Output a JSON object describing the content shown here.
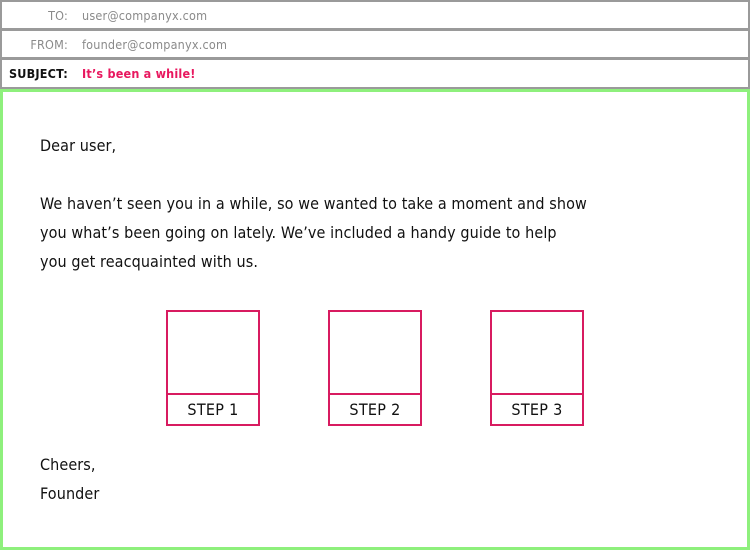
{
  "email": {
    "to_label": "TO:",
    "to_value": "user@companyx.com",
    "from_label": "FROM:",
    "from_value": "founder@companyx.com",
    "subject_label": "SUBJECT:",
    "subject_value": "It’s been a while!"
  },
  "body": {
    "greeting": "Dear user,",
    "paragraph_lines": [
      "We haven’t seen you in a while, so we wanted to take a moment and show",
      "you what’s been going on lately.  We’ve included a handy guide to help",
      "you get reacquainted with us."
    ],
    "steps": [
      {
        "label": "STEP 1"
      },
      {
        "label": "STEP 2"
      },
      {
        "label": "STEP 3"
      }
    ],
    "signoff": "Cheers,",
    "signature": "Founder"
  },
  "colors": {
    "accent": "#e8185f",
    "body_border": "#8ef07c",
    "header_border": "#9a9a9a"
  }
}
